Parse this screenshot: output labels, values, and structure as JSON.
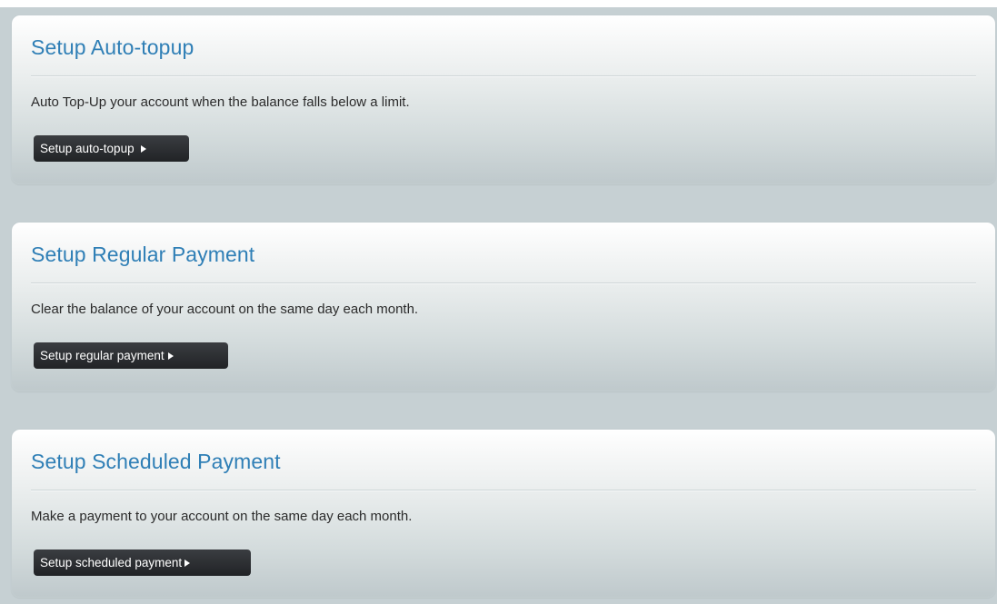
{
  "cards": [
    {
      "title": "Setup Auto-topup",
      "description": "Auto Top-Up your account when the balance falls below a limit.",
      "button_label": "Setup auto-topup",
      "button_icon": "play-arrow-icon"
    },
    {
      "title": "Setup Regular Payment",
      "description": "Clear the balance of your account on the same day each month.",
      "button_label": "Setup regular payment",
      "button_icon": "play-arrow-icon"
    },
    {
      "title": "Setup Scheduled Payment",
      "description": "Make a payment to your account on the same day each month.",
      "button_label": "Setup scheduled payment",
      "button_icon": "play-arrow-icon"
    }
  ],
  "colors": {
    "title": "#2f7fb6",
    "button_background": "#2a2c2f",
    "page_background": "#c6d0d3"
  }
}
